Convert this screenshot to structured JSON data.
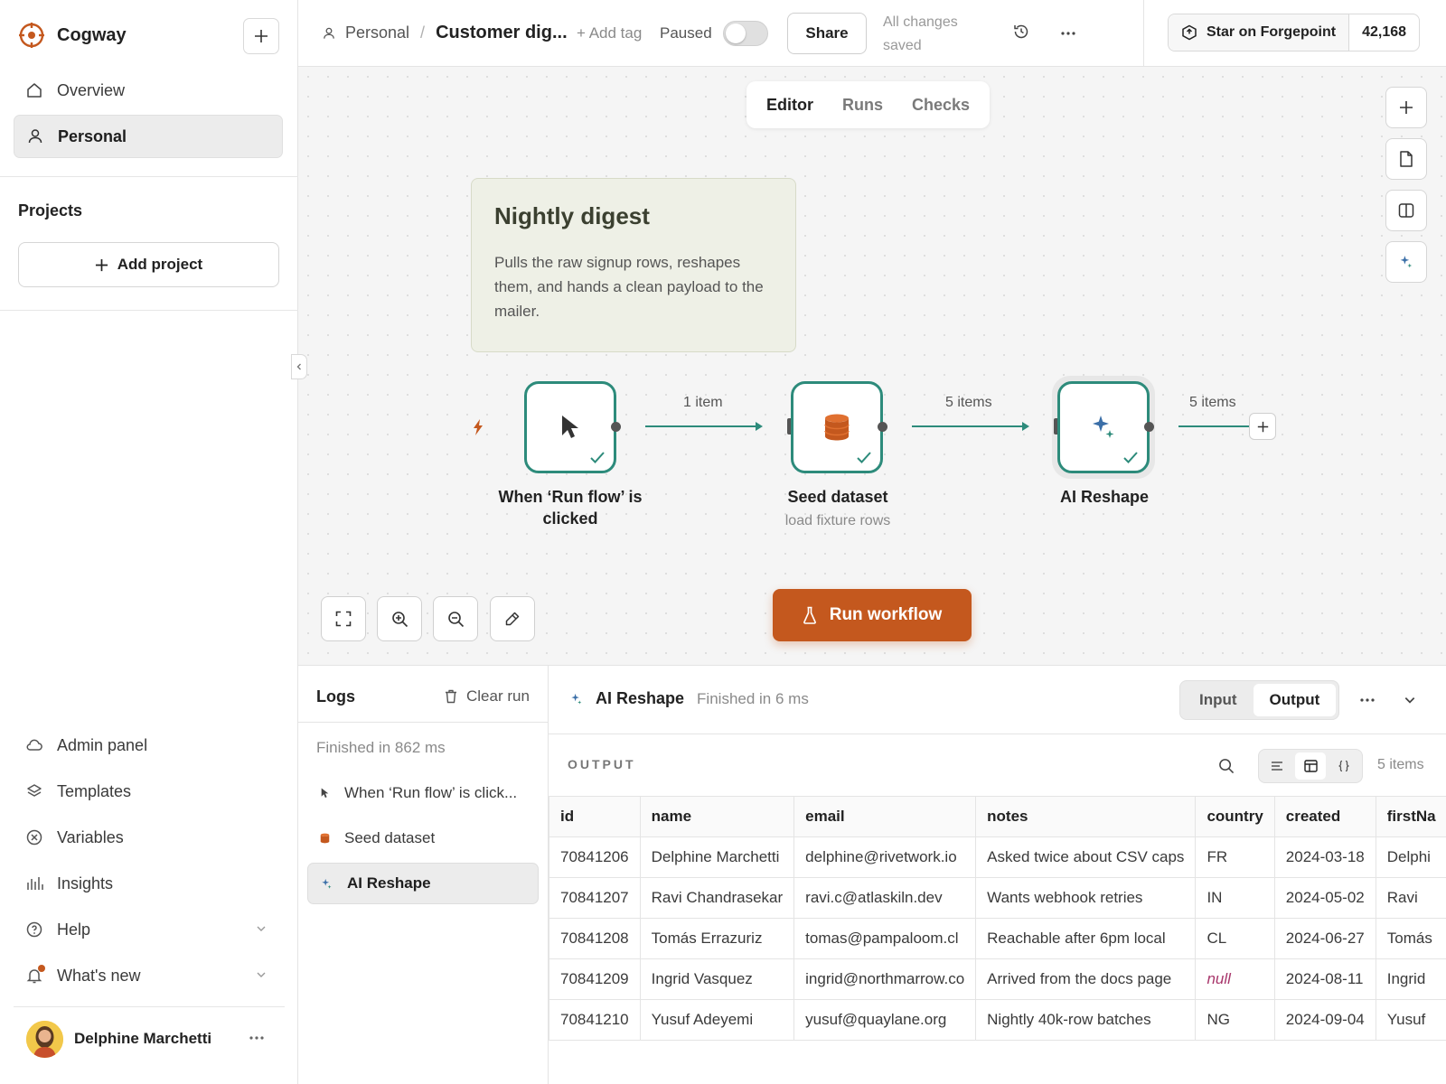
{
  "app": {
    "name": "Cogway"
  },
  "sidebar": {
    "nav": [
      {
        "label": "Overview",
        "icon": "home-icon"
      },
      {
        "label": "Personal",
        "icon": "user-icon",
        "active": true
      }
    ],
    "projects_title": "Projects",
    "add_project_label": "Add project",
    "bottom": [
      {
        "label": "Admin panel",
        "icon": "cloud-icon"
      },
      {
        "label": "Templates",
        "icon": "layers-icon"
      },
      {
        "label": "Variables",
        "icon": "variables-icon"
      },
      {
        "label": "Insights",
        "icon": "insights-icon"
      },
      {
        "label": "Help",
        "icon": "help-icon",
        "chevron": true
      },
      {
        "label": "What's new",
        "icon": "bell-icon",
        "chevron": true
      }
    ],
    "user": {
      "name": "Delphine Marchetti"
    }
  },
  "header": {
    "crumb_parent": "Personal",
    "crumb_sep": "/",
    "workflow_name": "Customer dig...",
    "add_tag": "+ Add tag",
    "paused_label": "Paused",
    "share_label": "Share",
    "saved_status": "All changes saved",
    "star_label": "Star on Forgepoint",
    "star_count": "42,168"
  },
  "canvas": {
    "tabs": [
      "Editor",
      "Runs",
      "Checks"
    ],
    "active_tab": "Editor",
    "sticky": {
      "title": "Nightly digest",
      "body": "Pulls the raw signup rows, reshapes them, and hands a clean payload to the mailer."
    },
    "nodes": [
      {
        "label": "When ‘Run flow’ is clicked",
        "sub": ""
      },
      {
        "label": "Seed dataset",
        "sub": "load fixture rows"
      },
      {
        "label": "AI Reshape",
        "sub": ""
      }
    ],
    "edges": [
      "1 item",
      "5 items",
      "5 items"
    ],
    "run_button": "Run workflow",
    "accent": "#c4581e",
    "node_color": "#2d8b7b"
  },
  "logs": {
    "title": "Logs",
    "clear_label": "Clear run",
    "status": "Finished in 862 ms",
    "items": [
      {
        "label": "When ‘Run flow’ is click..."
      },
      {
        "label": "Seed dataset"
      },
      {
        "label": "AI Reshape",
        "active": true
      }
    ]
  },
  "output": {
    "node_title": "AI Reshape",
    "node_status": "Finished in 6 ms",
    "toggle": [
      "Input",
      "Output"
    ],
    "active_toggle": "Output",
    "section_label": "OUTPUT",
    "item_count": "5 items",
    "columns": [
      "id",
      "name",
      "email",
      "notes",
      "country",
      "created",
      "firstNa"
    ],
    "rows": [
      [
        "70841206",
        "Delphine Marchetti",
        "delphine@rivetwork.io",
        "Asked twice about CSV caps",
        "FR",
        "2024-03-18",
        "Delphi"
      ],
      [
        "70841207",
        "Ravi Chandrasekar",
        "ravi.c@atlaskiln.dev",
        "Wants webhook retries",
        "IN",
        "2024-05-02",
        "Ravi"
      ],
      [
        "70841208",
        "Tomás Errazuriz",
        "tomas@pampaloom.cl",
        "Reachable after 6pm local",
        "CL",
        "2024-06-27",
        "Tomás"
      ],
      [
        "70841209",
        "Ingrid Vasquez",
        "ingrid@northmarrow.co",
        "Arrived from the docs page",
        "null",
        "2024-08-11",
        "Ingrid"
      ],
      [
        "70841210",
        "Yusuf Adeyemi",
        "yusuf@quaylane.org",
        "Nightly 40k-row batches",
        "NG",
        "2024-09-04",
        "Yusuf"
      ]
    ]
  }
}
